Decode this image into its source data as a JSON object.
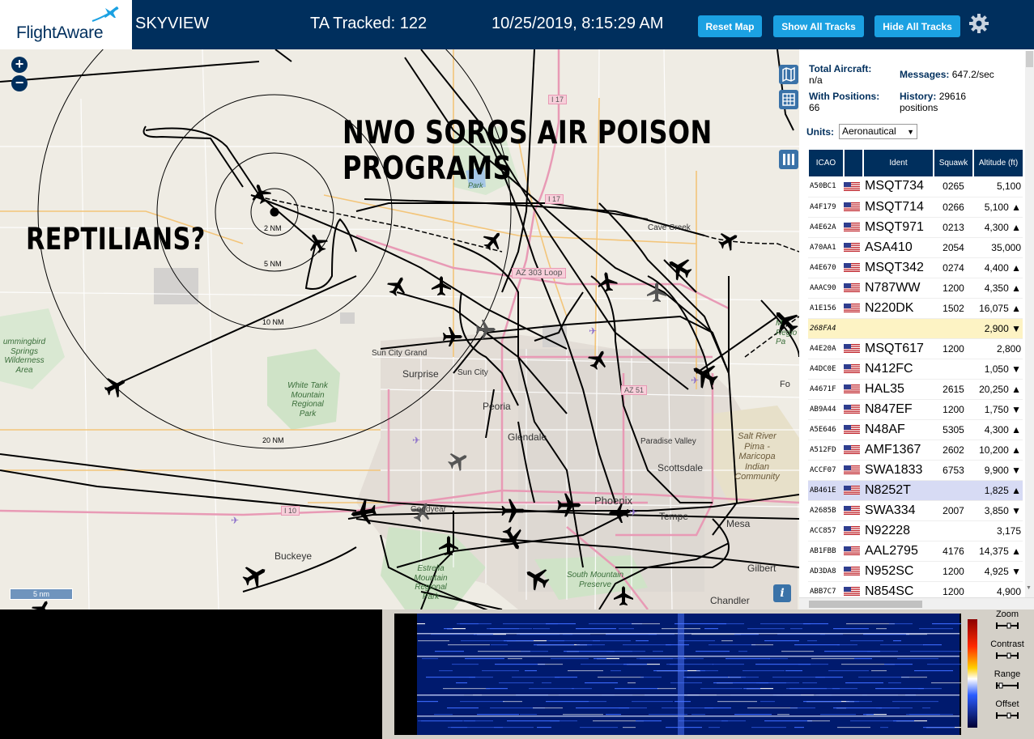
{
  "header": {
    "logo_text": "FlightAware",
    "app_name": "SKYVIEW",
    "tracked": "TA Tracked: 122",
    "datetime": "10/25/2019, 8:15:29 AM",
    "buttons": {
      "reset": "Reset Map",
      "show_all": "Show All Tracks",
      "hide_all": "Hide All Tracks"
    }
  },
  "map": {
    "overlay_text_1_line1": "NWO SOROS AIR POISON",
    "overlay_text_1_line2": "PROGRAMS",
    "overlay_text_2": "REPTILIANS?",
    "range_labels": {
      "r2": "2 NM",
      "r5": "5 NM",
      "r10": "10 NM",
      "r20": "20 NM"
    },
    "places": {
      "surprise": "Surprise",
      "sun_city": "Sun City",
      "sun_city_grand": "Sun City Grand",
      "peoria": "Peoria",
      "glendale": "Glendale",
      "scottsdale": "Scottsdale",
      "phoenix": "Phoenix",
      "tempe": "Tempe",
      "mesa": "Mesa",
      "buckeye": "Buckeye",
      "goodyear": "Goodyear",
      "chandler": "Chandler",
      "gilbert": "Gilbert",
      "paradise_valley": "Paradise Valley",
      "cave_creek": "Cave Creek",
      "park": "Park",
      "fo": "Fo",
      "white_tank_l1": "White Tank",
      "white_tank_l2": "Mountain",
      "white_tank_l3": "Regional",
      "white_tank_l4": "Park",
      "hummingbird_l1": "ummingbird",
      "hummingbird_l2": "Springs",
      "hummingbird_l3": "Wilderness",
      "hummingbird_l4": "Area",
      "estrella_l1": "Estrella",
      "estrella_l2": "Mountain",
      "estrella_l3": "Regional",
      "estrella_l4": "Park",
      "south_mountain_l1": "South Mountain",
      "south_mountain_l2": "Preserve",
      "salt_river_l1": "Salt River",
      "salt_river_l2": "Pima -",
      "salt_river_l3": "Maricopa",
      "salt_river_l4": "Indian",
      "salt_river_l5": "Community",
      "regio_l1": "M",
      "regio_l2": "Regio",
      "regio_l3": "Pa"
    },
    "highways": {
      "i17a": "I 17",
      "i17b": "I 17",
      "az303": "AZ 303 Loop",
      "az51": "AZ 51",
      "i10": "I 10"
    },
    "scale": "5 nm",
    "info": "i"
  },
  "panel": {
    "total_aircraft_label": "Total Aircraft:",
    "total_aircraft_value": "n/a",
    "with_positions_label": "With Positions:",
    "with_positions_value": "66",
    "messages_label": "Messages:",
    "messages_value": "647.2/sec",
    "history_label": "History:",
    "history_value": "29616",
    "history_unit": "positions",
    "units_label": "Units:",
    "units_value": "Aeronautical",
    "columns": [
      "ICAO",
      "",
      "Ident",
      "Squawk",
      "Altitude (ft)"
    ],
    "rows": [
      {
        "icao": "A50BC1",
        "flag": true,
        "ident": "MSQT734",
        "squawk": "0265",
        "alt": "5,100",
        "trend": ""
      },
      {
        "icao": "A4F179",
        "flag": true,
        "ident": "MSQT714",
        "squawk": "0266",
        "alt": "5,100",
        "trend": "▲"
      },
      {
        "icao": "A4E62A",
        "flag": true,
        "ident": "MSQT971",
        "squawk": "0213",
        "alt": "4,300",
        "trend": "▲"
      },
      {
        "icao": "A70AA1",
        "flag": true,
        "ident": "ASA410",
        "squawk": "2054",
        "alt": "35,000",
        "trend": ""
      },
      {
        "icao": "A4E670",
        "flag": true,
        "ident": "MSQT342",
        "squawk": "0274",
        "alt": "4,400",
        "trend": "▲"
      },
      {
        "icao": "AAAC90",
        "flag": true,
        "ident": "N787WW",
        "squawk": "1200",
        "alt": "4,350",
        "trend": "▲"
      },
      {
        "icao": "A1E156",
        "flag": true,
        "ident": "N220DK",
        "squawk": "1502",
        "alt": "16,075",
        "trend": "▲"
      },
      {
        "icao": "268FA4",
        "flag": false,
        "ident": "",
        "squawk": "",
        "alt": "2,900",
        "trend": "▼",
        "hl": "yellow"
      },
      {
        "icao": "A4E20A",
        "flag": true,
        "ident": "MSQT617",
        "squawk": "1200",
        "alt": "2,800",
        "trend": ""
      },
      {
        "icao": "A4DC0E",
        "flag": true,
        "ident": "N412FC",
        "squawk": "",
        "alt": "1,050",
        "trend": "▼"
      },
      {
        "icao": "A4671F",
        "flag": true,
        "ident": "HAL35",
        "squawk": "2615",
        "alt": "20,250",
        "trend": "▲"
      },
      {
        "icao": "AB9A44",
        "flag": true,
        "ident": "N847EF",
        "squawk": "1200",
        "alt": "1,750",
        "trend": "▼"
      },
      {
        "icao": "A5E646",
        "flag": true,
        "ident": "N48AF",
        "squawk": "5305",
        "alt": "4,300",
        "trend": "▲"
      },
      {
        "icao": "A512FD",
        "flag": true,
        "ident": "AMF1367",
        "squawk": "2602",
        "alt": "10,200",
        "trend": "▲"
      },
      {
        "icao": "ACCF07",
        "flag": true,
        "ident": "SWA1833",
        "squawk": "6753",
        "alt": "9,900",
        "trend": "▼"
      },
      {
        "icao": "AB461E",
        "flag": true,
        "ident": "N8252T",
        "squawk": "",
        "alt": "1,825",
        "trend": "▲",
        "hl": "blue"
      },
      {
        "icao": "A2685B",
        "flag": true,
        "ident": "SWA334",
        "squawk": "2007",
        "alt": "3,850",
        "trend": "▼"
      },
      {
        "icao": "ACC857",
        "flag": true,
        "ident": "N92228",
        "squawk": "",
        "alt": "3,175",
        "trend": ""
      },
      {
        "icao": "AB1FBB",
        "flag": true,
        "ident": "AAL2795",
        "squawk": "4176",
        "alt": "14,375",
        "trend": "▲"
      },
      {
        "icao": "AD3DA8",
        "flag": true,
        "ident": "N952SC",
        "squawk": "1200",
        "alt": "4,925",
        "trend": "▼"
      },
      {
        "icao": "ABB7C7",
        "flag": true,
        "ident": "N854SC",
        "squawk": "1200",
        "alt": "4,900",
        "trend": ""
      }
    ]
  },
  "waterfall": {
    "controls": [
      "Zoom",
      "Contrast",
      "Range",
      "Offset"
    ]
  },
  "colors": {
    "header_bg": "#002f5d",
    "button": "#1ba1e2",
    "map_bg": "#efece4",
    "track": "#000000",
    "highway": "#e89ab5"
  }
}
